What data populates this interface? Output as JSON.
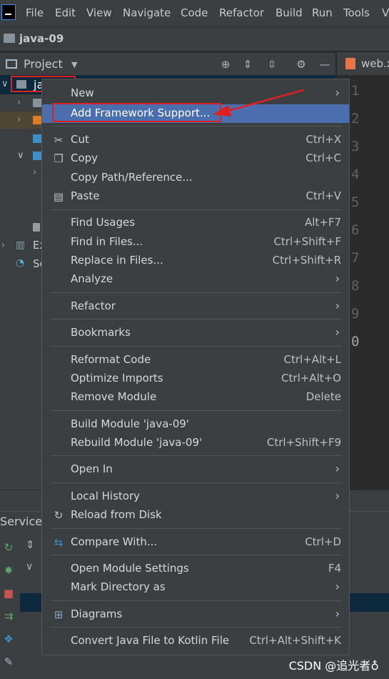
{
  "menubar": {
    "items": [
      "File",
      "Edit",
      "View",
      "Navigate",
      "Code",
      "Refactor",
      "Build",
      "Run",
      "Tools",
      "V"
    ]
  },
  "navbar": {
    "project": "java-09"
  },
  "project_panel": {
    "title": "Project",
    "root_label": "ja",
    "partial_items": [
      "Ex",
      "Sc"
    ]
  },
  "editor": {
    "tab_name": "web.x",
    "line_numbers": [
      "1",
      "2",
      "3",
      "4",
      "5",
      "6",
      "7",
      "8",
      "9",
      "0"
    ]
  },
  "services": {
    "title": "Services"
  },
  "context_menu": {
    "new": "New",
    "add_framework_support": "Add Framework Support...",
    "cut": "Cut",
    "cut_shortcut": "Ctrl+X",
    "copy": "Copy",
    "copy_shortcut": "Ctrl+C",
    "copy_path": "Copy Path/Reference...",
    "paste": "Paste",
    "paste_shortcut": "Ctrl+V",
    "find_usages": "Find Usages",
    "find_usages_shortcut": "Alt+F7",
    "find_in_files": "Find in Files...",
    "find_in_files_shortcut": "Ctrl+Shift+F",
    "replace_in_files": "Replace in Files...",
    "replace_in_files_shortcut": "Ctrl+Shift+R",
    "analyze": "Analyze",
    "refactor": "Refactor",
    "bookmarks": "Bookmarks",
    "reformat_code": "Reformat Code",
    "reformat_code_shortcut": "Ctrl+Alt+L",
    "optimize_imports": "Optimize Imports",
    "optimize_imports_shortcut": "Ctrl+Alt+O",
    "remove_module": "Remove Module",
    "remove_module_shortcut": "Delete",
    "build_module": "Build Module 'java-09'",
    "rebuild_module": "Rebuild Module 'java-09'",
    "rebuild_module_shortcut": "Ctrl+Shift+F9",
    "open_in": "Open In",
    "local_history": "Local History",
    "reload_from_disk": "Reload from Disk",
    "compare_with": "Compare With...",
    "compare_with_shortcut": "Ctrl+D",
    "open_module_settings": "Open Module Settings",
    "open_module_settings_shortcut": "F4",
    "mark_directory_as": "Mark Directory as",
    "diagrams": "Diagrams",
    "convert_java_to_kotlin": "Convert Java File to Kotlin File",
    "convert_java_to_kotlin_shortcut": "Ctrl+Alt+Shift+K"
  },
  "watermark": "CSDN @追光者♁",
  "colors": {
    "menu_bg": "#3c3f41",
    "highlight": "#4b6eaf",
    "annotation_red": "#e02020",
    "selection": "#0d293e"
  }
}
